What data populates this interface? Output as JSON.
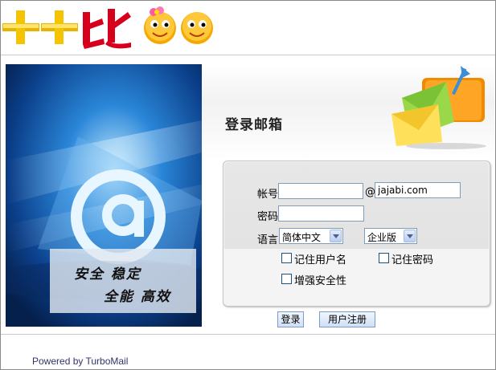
{
  "header": {
    "logo_icon": "plus-plus-bi-logo-with-smileys"
  },
  "banner": {
    "slogan_line1": "安全  稳定",
    "slogan_line2": "全能  高效",
    "image_icon": "email-at-sign-banner"
  },
  "login": {
    "title": "登录邮箱",
    "account_label": "帐号",
    "account_value": "",
    "at_sign": "@",
    "domain_value": "jajabi.com",
    "password_label": "密码",
    "password_value": "",
    "language_label": "语言",
    "language_selected": "简体中文",
    "edition_selected": "企业版",
    "remember_user_label": "记住用户名",
    "remember_password_label": "记住密码",
    "enhanced_security_label": "增强安全性"
  },
  "buttons": {
    "login": "登录",
    "register": "用户注册"
  },
  "footer": {
    "powered_by": "Powered by TurboMail"
  },
  "colors": {
    "brand_red": "#d6001c",
    "plus_yellow": "#f5c400",
    "button_border": "#7a9ccc",
    "footer_text": "#333366"
  }
}
